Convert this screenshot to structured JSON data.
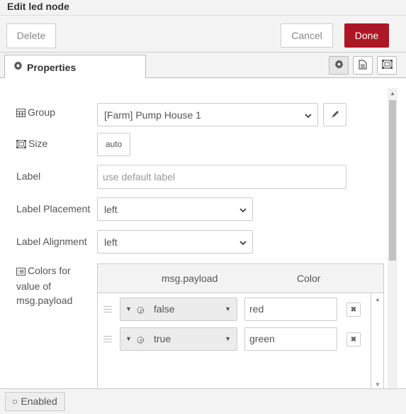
{
  "tray": {
    "title": "Edit led node"
  },
  "toolbar": {
    "delete_label": "Delete",
    "cancel_label": "Cancel",
    "done_label": "Done"
  },
  "tabs": {
    "properties_label": "Properties"
  },
  "form": {
    "group": {
      "label": "Group",
      "value": "[Farm] Pump House 1"
    },
    "size": {
      "label": "Size",
      "value": "auto"
    },
    "label_field": {
      "label": "Label",
      "placeholder": "use default label",
      "value": ""
    },
    "placement": {
      "label": "Label Placement",
      "value": "left"
    },
    "alignment": {
      "label": "Label Alignment",
      "value": "left"
    },
    "colors": {
      "label": "Colors for value of msg.payload",
      "col_payload": "msg.payload",
      "col_color": "Color",
      "rows": [
        {
          "value": "false",
          "color": "red"
        },
        {
          "value": "true",
          "color": "green"
        }
      ]
    }
  },
  "footer": {
    "enabled_label": "Enabled"
  },
  "colors": {
    "accent": "#ad1625"
  }
}
